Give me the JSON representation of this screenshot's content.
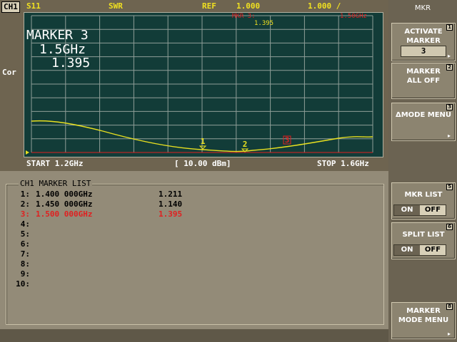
{
  "header": {
    "channel": "CH1",
    "parameter": "S11",
    "format": "SWR",
    "ref_label": "REF",
    "ref_value": "1.000",
    "scale": "1.000 /"
  },
  "plot": {
    "marker_title": "MARKER 3",
    "marker_freq": "1.5GHz",
    "marker_value": "1.395",
    "mkr_readout_label": "MKR 3:",
    "mkr_readout_freq": "1.50GHz",
    "mkr_readout_value": "1.395",
    "cor_label": "Cor",
    "markers": [
      "1",
      "2",
      "3"
    ]
  },
  "footer": {
    "start": "START 1.2GHz",
    "power": "[ 10.00 dBm]",
    "stop": "STOP 1.6GHz"
  },
  "marker_list": {
    "title": "CH1 MARKER LIST",
    "rows": [
      {
        "num": "1:",
        "freq": "1.400 000GHz",
        "value": "1.211",
        "active": false
      },
      {
        "num": "2:",
        "freq": "1.450 000GHz",
        "value": "1.140",
        "active": false
      },
      {
        "num": "3:",
        "freq": "1.500 000GHz",
        "value": "1.395",
        "active": true
      },
      {
        "num": "4:",
        "freq": "",
        "value": "",
        "active": false
      },
      {
        "num": "5:",
        "freq": "",
        "value": "",
        "active": false
      },
      {
        "num": "6:",
        "freq": "",
        "value": "",
        "active": false
      },
      {
        "num": "7:",
        "freq": "",
        "value": "",
        "active": false
      },
      {
        "num": "8:",
        "freq": "",
        "value": "",
        "active": false
      },
      {
        "num": "9:",
        "freq": "",
        "value": "",
        "active": false
      },
      {
        "num": "10:",
        "freq": "",
        "value": "",
        "active": false
      }
    ]
  },
  "softkeys": {
    "menu_title": "MKR",
    "activate": {
      "line1": "ACTIVATE",
      "line2": "MARKER",
      "value": "3",
      "num": "1"
    },
    "all_off": {
      "line1": "MARKER",
      "line2": "ALL OFF",
      "num": "2"
    },
    "delta_mode": {
      "line1": "ΔMODE MENU",
      "num": "3"
    },
    "mkr_list": {
      "line1": "MKR LIST",
      "on": "ON",
      "off": "OFF",
      "num": "5"
    },
    "split_list": {
      "line1": "SPLIT LIST",
      "on": "ON",
      "off": "OFF",
      "num": "6"
    },
    "mode_menu": {
      "line1": "MARKER",
      "line2": "MODE MENU",
      "num": "8"
    }
  },
  "colors": {
    "trace": "#e8e020",
    "active_marker": "#e02020",
    "plot_bg": "#123c38"
  }
}
